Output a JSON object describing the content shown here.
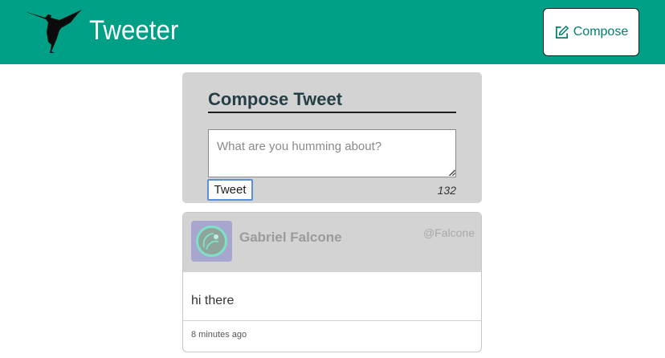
{
  "nav": {
    "brand": "Tweeter",
    "logo_icon": "hummingbird-logo-icon",
    "compose_label": "Compose",
    "compose_icon": "edit-icon",
    "background_color": "#00a087"
  },
  "compose": {
    "title": "Compose Tweet",
    "placeholder": "What are you humming about?",
    "value": "",
    "submit_label": "Tweet",
    "counter": "132"
  },
  "tweets": [
    {
      "avatar_icon": "avatar-icon",
      "name": "Gabriel Falcone",
      "handle": "@Falcone",
      "text": "hi there",
      "time": "8 minutes ago"
    }
  ]
}
